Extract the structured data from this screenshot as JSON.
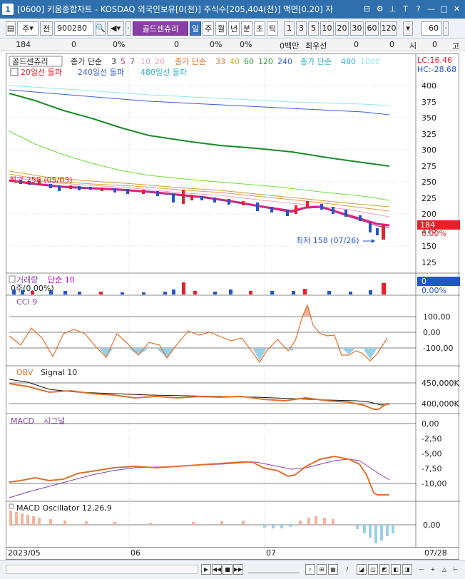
{
  "window": {
    "number": "1",
    "title": "[0600] 키움종합차트 - KOSDAQ 외국인보유[0(천)] 주식수[205,404(천)] 액면[0.20] 자"
  },
  "toolbar": {
    "period": "주",
    "prev": "전",
    "code": "900280",
    "name": "골드센츄리",
    "tabs": [
      "일",
      "주",
      "월",
      "년",
      "분",
      "초",
      "틱"
    ],
    "nums": [
      "1",
      "3",
      "5",
      "10",
      "20",
      "30",
      "60",
      "120"
    ],
    "count": "60"
  },
  "info": {
    "price": "184",
    "change": "0",
    "rate": "0%",
    "volume": "0",
    "vol_rate": "0%",
    "amount": "0백만",
    "broker": "최우선",
    "bid": "0",
    "ask": "0",
    "time_label": "시",
    "time_val": "0",
    "high_label": "고"
  },
  "legend": {
    "name": "골드센츄리",
    "price_ma": "종가 단순",
    "ma_periods": [
      "3",
      "5",
      "7",
      "10",
      "20"
    ],
    "price_ma2": "종가 단순",
    "ma2_periods": [
      "33",
      "40",
      "60",
      "120",
      "240"
    ],
    "price_ma3": "종가 단순",
    "ma3_periods": [
      "480",
      "1000"
    ],
    "break1": "20일선 돌파",
    "break2": "240일선 돌파",
    "break3": "480일선 돌파",
    "lc": "LC:16.46",
    "hc": "HC:-28.68"
  },
  "annotations": {
    "high": "최고 258 (05/03)",
    "low": "최저 158 (07/26)"
  },
  "price_axis": [
    "400",
    "375",
    "350",
    "325",
    "300",
    "275",
    "250",
    "225",
    "200",
    "175",
    "150",
    "125"
  ],
  "price_badge": {
    "value": "184",
    "pct": "0.00%"
  },
  "volume_panel": {
    "title": "거래량",
    "ma": "단순 10",
    "current": "0주(0.00%)",
    "badge": "0",
    "pct": "0.00%"
  },
  "cci_panel": {
    "title": "CCI 9",
    "ticks": [
      "100,00",
      "0,00",
      "-100,00"
    ]
  },
  "obv_panel": {
    "title": "OBV",
    "signal": "Signal 10",
    "ticks": [
      "450,000K",
      "400,000K"
    ]
  },
  "macd_panel": {
    "title": "MACD",
    "signal": "시그널",
    "ticks": [
      "0,00",
      "-2,50",
      "-5,00",
      "-7,50",
      "-10,00"
    ]
  },
  "osc_panel": {
    "title": "MACD Oscillator 12,26,9",
    "ticks": [
      "0,00"
    ]
  },
  "xaxis": {
    "labels": [
      "2023/05",
      "06",
      "07"
    ],
    "right": "07/28"
  },
  "colors": {
    "titlebar": "#2f6fad",
    "up": "#e8202a",
    "down": "#2156c8",
    "badge": "#e8202a",
    "vol_badge": "#2156c8"
  }
}
